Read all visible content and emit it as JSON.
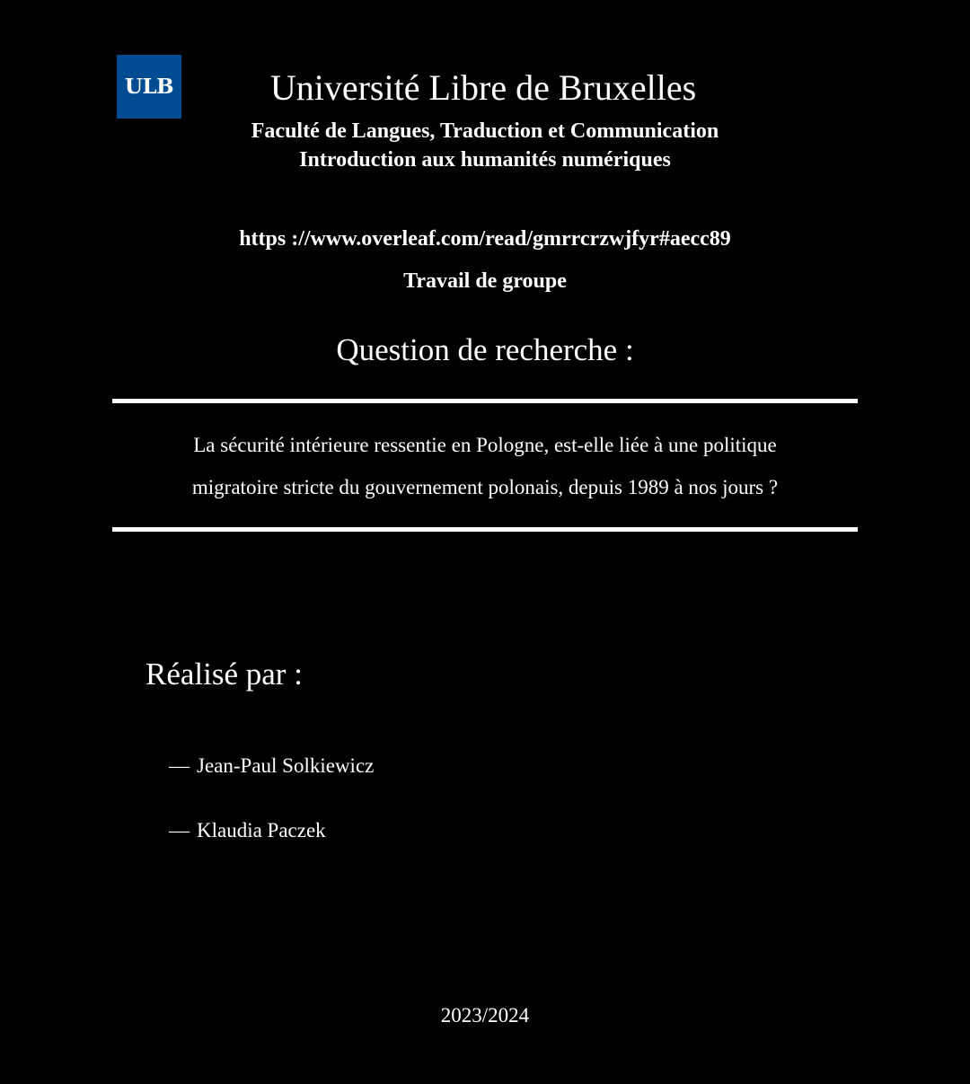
{
  "header": {
    "logo_text": "ULB",
    "logo_color": "#004c93",
    "university": "Université Libre de Bruxelles",
    "faculty": "Faculté de Langues, Traduction et Communication",
    "course": "Introduction aux humanités numériques"
  },
  "url": "https ://www.overleaf.com/read/gmrrcrzwjfyr#aecc89",
  "work_type": "Travail de groupe",
  "research": {
    "heading": "Question de recherche :",
    "line1": "La sécurité intérieure ressentie en Pologne, est-elle liée à une politique",
    "line2": "migratoire stricte du gouvernement polonais, depuis 1989 à nos jours ?"
  },
  "authors": {
    "heading": "Réalisé par :",
    "dash": "—",
    "items": [
      "Jean-Paul Solkiewicz",
      "Klaudia Paczek"
    ]
  },
  "year": "2023/2024"
}
